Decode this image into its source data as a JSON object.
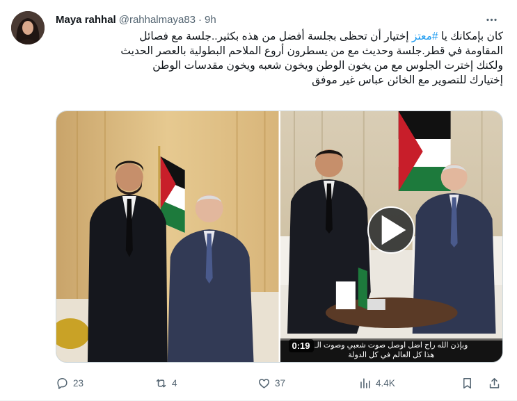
{
  "author": {
    "display_name": "Maya rahhal",
    "handle": "@rahhalmaya83",
    "separator": "·",
    "time": "9h"
  },
  "tweet": {
    "line1_prefix": "كان بإمكانك يا",
    "line1_hashtag": "#معتز",
    "line1_suffix": "إختيار أن تحظى بجلسة أفضل من هذه بكثير..جلسة مع فصائل",
    "line2": "المقاومة في قطر.جلسة وحديث مع من يسطرون أروع الملاحم البطولية بالعصر الحديث",
    "line3": "ولكنك إخترت الجلوس مع من يخون الوطن ويخون شعبه ويخون مقدسات الوطن",
    "line4": "إختيارك للتصوير مع الخائن عباس غير موفق"
  },
  "media": {
    "video_duration": "0:19",
    "caption_line1": "وبإذن الله راح اضل اوصل صوت شعبي وصوت الـ",
    "caption_line2": "هذا كل العالم في كل الدولة"
  },
  "actions": {
    "replies": "23",
    "retweets": "4",
    "likes": "37",
    "views": "4.4K"
  },
  "colors": {
    "accent": "#1d9bf0",
    "text": "#0f1419",
    "secondary": "#536471",
    "border": "#cfd9de"
  }
}
